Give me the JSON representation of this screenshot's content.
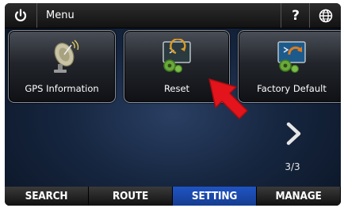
{
  "header": {
    "title": "Menu",
    "power_icon": "power-icon",
    "help_label": "?",
    "globe_icon": "globe-icon"
  },
  "tiles": [
    {
      "label": "GPS Information",
      "icon": "satellite-dish-icon"
    },
    {
      "label": "Reset",
      "icon": "reset-gears-icon"
    },
    {
      "label": "Factory Default",
      "icon": "factory-default-icon"
    }
  ],
  "pager": {
    "indicator": "3/3",
    "next_icon": "chevron-right-icon"
  },
  "tabs": [
    {
      "label": "SEARCH",
      "active": false
    },
    {
      "label": "ROUTE",
      "active": false
    },
    {
      "label": "SETTING",
      "active": true
    },
    {
      "label": "MANAGE",
      "active": false
    }
  ],
  "colors": {
    "active_tab": "#1f54c4",
    "pointer": "#e3141b"
  }
}
